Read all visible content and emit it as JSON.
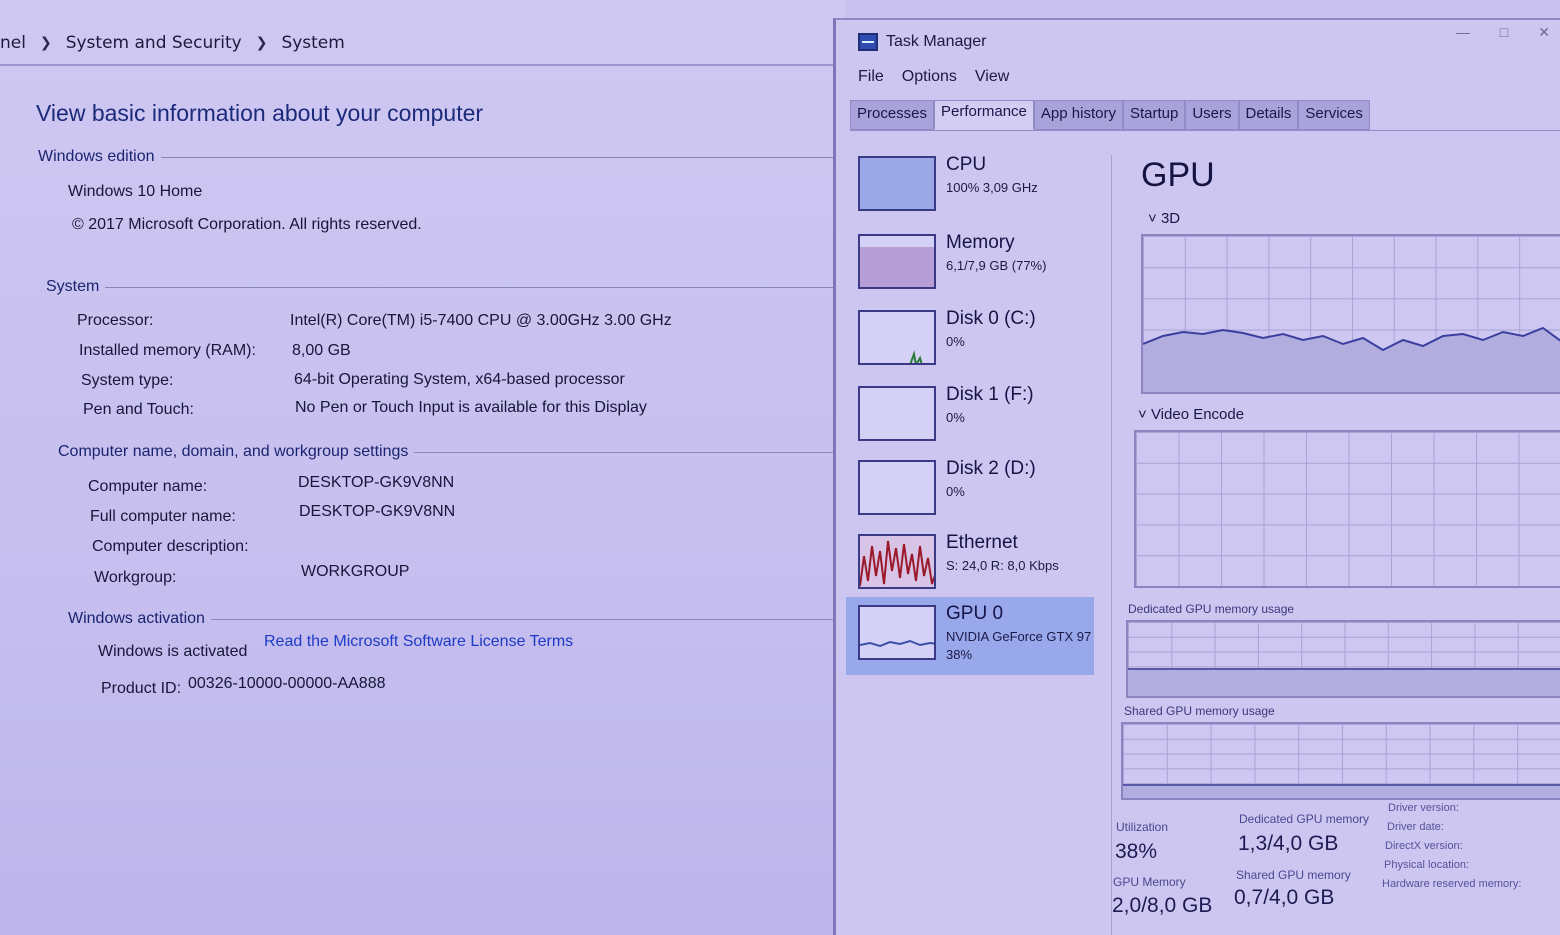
{
  "control_panel": {
    "breadcrumb": [
      "nel",
      "System and Security",
      "System"
    ],
    "title": "View basic information about your computer",
    "windows_edition": {
      "heading": "Windows edition",
      "edition": "Windows 10 Home",
      "copyright": "© 2017 Microsoft Corporation. All rights reserved."
    },
    "system": {
      "heading": "System",
      "rows": [
        {
          "label": "Processor:",
          "value": "Intel(R) Core(TM) i5-7400 CPU @ 3.00GHz   3.00 GHz"
        },
        {
          "label": "Installed memory (RAM):",
          "value": "8,00 GB"
        },
        {
          "label": "System type:",
          "value": "64-bit Operating System, x64-based processor"
        },
        {
          "label": "Pen and Touch:",
          "value": "No Pen or Touch Input is available for this Display"
        }
      ]
    },
    "computer_name": {
      "heading": "Computer name, domain, and workgroup settings",
      "rows": [
        {
          "label": "Computer name:",
          "value": "DESKTOP-GK9V8NN"
        },
        {
          "label": "Full computer name:",
          "value": "DESKTOP-GK9V8NN"
        },
        {
          "label": "Computer description:",
          "value": ""
        },
        {
          "label": "Workgroup:",
          "value": "WORKGROUP"
        }
      ]
    },
    "activation": {
      "heading": "Windows activation",
      "status": "Windows is activated",
      "link": "Read the Microsoft Software License Terms",
      "product_id_label": "Product ID:",
      "product_id": "00326-10000-00000-AA888"
    }
  },
  "task_manager": {
    "title": "Task Manager",
    "menu": [
      "File",
      "Options",
      "View"
    ],
    "tabs": [
      "Processes",
      "Performance",
      "App history",
      "Startup",
      "Users",
      "Details",
      "Services"
    ],
    "active_tab": "Performance",
    "side": [
      {
        "title": "CPU",
        "sub": "100%  3,09 GHz"
      },
      {
        "title": "Memory",
        "sub": "6,1/7,9 GB (77%)"
      },
      {
        "title": "Disk 0 (C:)",
        "sub": "0%"
      },
      {
        "title": "Disk 1 (F:)",
        "sub": "0%"
      },
      {
        "title": "Disk 2 (D:)",
        "sub": "0%"
      },
      {
        "title": "Ethernet",
        "sub": "S: 24,0  R: 8,0 Kbps"
      },
      {
        "title": "GPU 0",
        "sub": "NVIDIA GeForce GTX 97",
        "sub2": "38%"
      }
    ],
    "gpu_panel": {
      "heading": "GPU",
      "engine1": "3D",
      "engine2": "Video Encode",
      "dedicated_label": "Dedicated GPU memory usage",
      "shared_label": "Shared GPU memory usage",
      "stats": {
        "utilization_label": "Utilization",
        "utilization": "38%",
        "dedicated_label": "Dedicated GPU memory",
        "dedicated": "1,3/4,0 GB",
        "gpu_memory_label": "GPU Memory",
        "gpu_memory": "2,0/8,0 GB",
        "shared_label": "Shared GPU memory",
        "shared": "0,7/4,0 GB"
      },
      "properties": [
        "Driver version:",
        "Driver date:",
        "DirectX version:",
        "Physical location:",
        "Hardware reserved memory:"
      ]
    }
  }
}
